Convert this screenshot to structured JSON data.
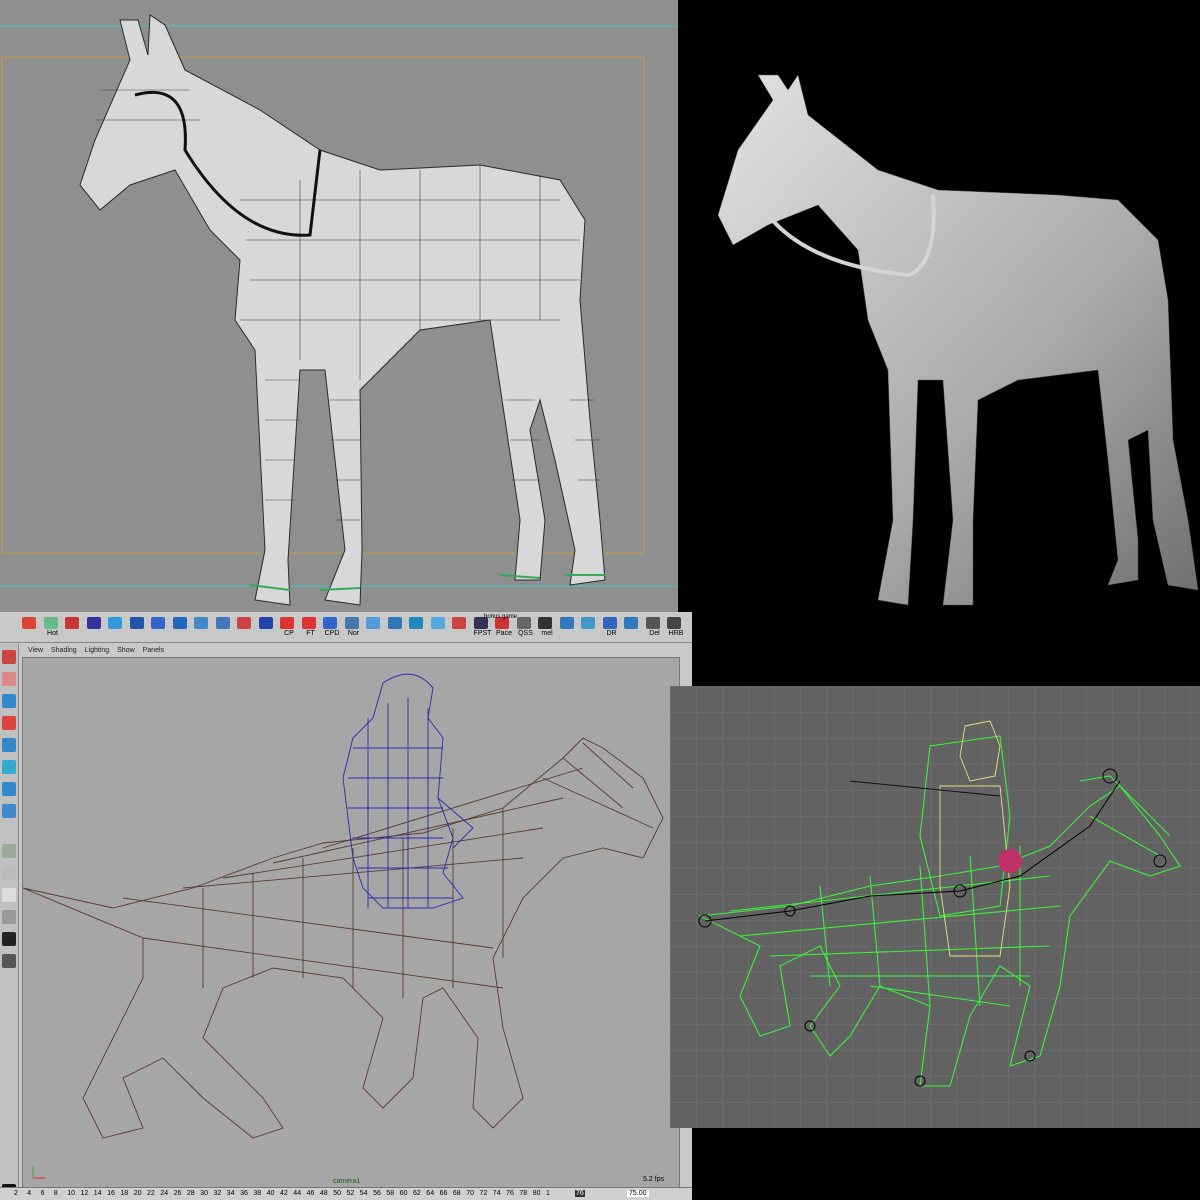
{
  "shelf": {
    "items": [
      {
        "label": "",
        "color": "#d43"
      },
      {
        "label": "Hot",
        "color": "#6b8"
      },
      {
        "label": "",
        "color": "#c33"
      },
      {
        "label": "",
        "color": "#339"
      },
      {
        "label": "",
        "color": "#39d"
      },
      {
        "label": "",
        "color": "#25a"
      },
      {
        "label": "",
        "color": "#36c"
      },
      {
        "label": "",
        "color": "#26b"
      },
      {
        "label": "",
        "color": "#48c"
      },
      {
        "label": "",
        "color": "#47b"
      },
      {
        "label": "",
        "color": "#c44"
      },
      {
        "label": "",
        "color": "#24a"
      },
      {
        "label": "CP",
        "color": "#d33"
      },
      {
        "label": "FT",
        "color": "#d33"
      },
      {
        "label": "CPD",
        "color": "#36c"
      },
      {
        "label": "Nor",
        "color": "#47a"
      },
      {
        "label": "",
        "color": "#59d"
      },
      {
        "label": "",
        "color": "#37b"
      },
      {
        "label": "",
        "color": "#28b"
      },
      {
        "label": "",
        "color": "#5ad"
      },
      {
        "label": "",
        "color": "#c44"
      },
      {
        "label": "FPST",
        "color": "#335"
      },
      {
        "label": "Pace",
        "color": "#c33"
      },
      {
        "label": "QSS",
        "color": "#666"
      },
      {
        "label": "mel",
        "color": "#333"
      },
      {
        "label": "",
        "color": "#37b"
      },
      {
        "label": "",
        "color": "#49c"
      },
      {
        "label": "DR",
        "color": "#36b"
      },
      {
        "label": "",
        "color": "#37b"
      },
      {
        "label": "Del",
        "color": "#555"
      },
      {
        "label": "HRB",
        "color": "#444"
      }
    ],
    "bonus_label": "bonus game"
  },
  "viewport": {
    "menu": [
      "View",
      "Shading",
      "Lighting",
      "Show",
      "Panels"
    ],
    "camera_label": "camera1",
    "fps_label": "5.2 fps",
    "timeline_ticks": [
      "2",
      "4",
      "6",
      "8",
      "10",
      "12",
      "14",
      "16",
      "18",
      "20",
      "22",
      "24",
      "26",
      "28",
      "30",
      "32",
      "34",
      "36",
      "38",
      "40",
      "42",
      "44",
      "46",
      "48",
      "50",
      "52",
      "54",
      "56",
      "58",
      "60",
      "62",
      "64",
      "66",
      "68",
      "70",
      "72",
      "74",
      "76",
      "78",
      "80",
      "1"
    ],
    "current_frame": "76",
    "frame_field": "75.00"
  },
  "colors": {
    "grid_lines": "#5fb4b4",
    "safe_frame": "#c89a40",
    "rider_wire": "#2a2ab0",
    "horse_wire": "#5a3a30",
    "rig_green": "#3cf03c"
  }
}
